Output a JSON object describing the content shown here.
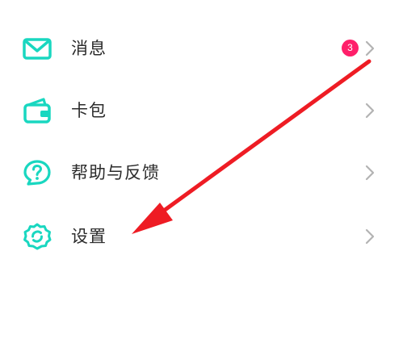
{
  "colors": {
    "accent": "#19d7c0",
    "badge": "#ff1f6a",
    "chevron": "#b3b3b3",
    "arrow": "#ee1c24"
  },
  "menu": {
    "items": [
      {
        "label": "消息",
        "icon": "mail-icon",
        "badge": "3"
      },
      {
        "label": "卡包",
        "icon": "wallet-icon"
      },
      {
        "label": "帮助与反馈",
        "icon": "help-icon"
      },
      {
        "label": "设置",
        "icon": "settings-icon"
      }
    ]
  }
}
